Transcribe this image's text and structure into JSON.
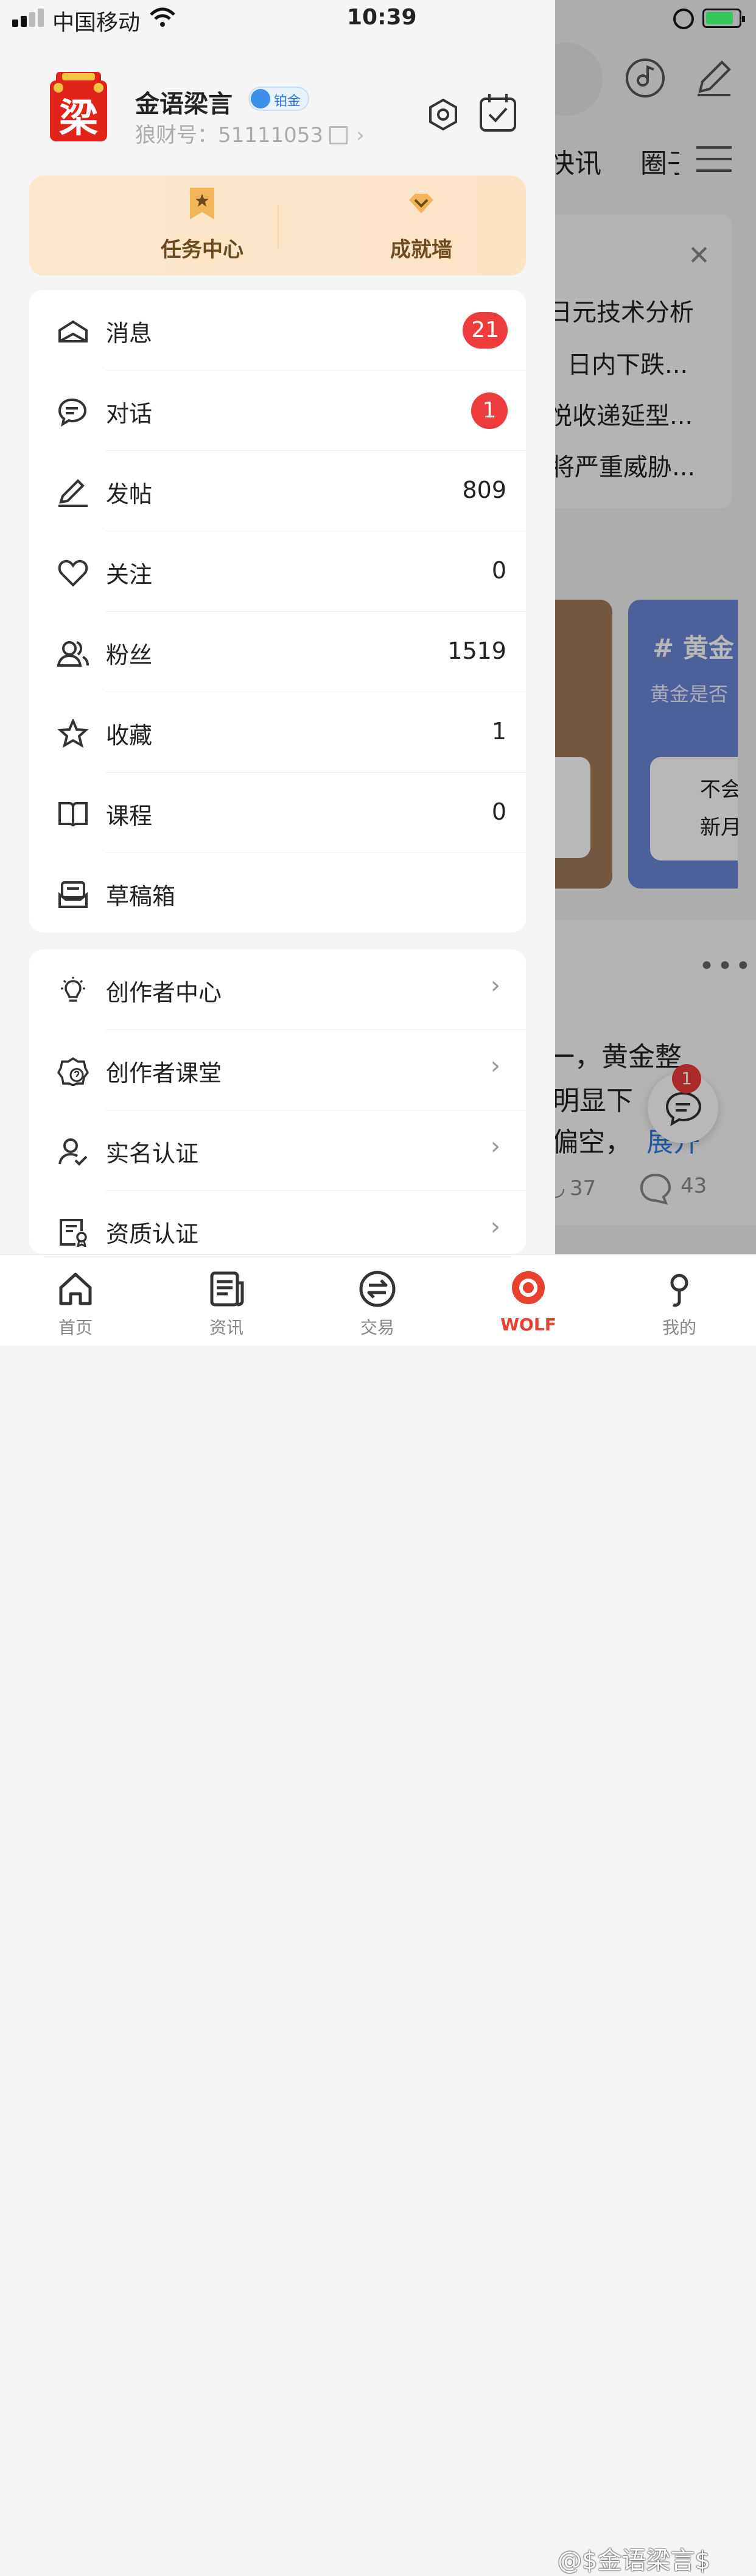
{
  "status": {
    "carrier": "中国移动",
    "time": "10:39"
  },
  "profile": {
    "name": "金语梁言",
    "tier": "铂金",
    "id_label": "狼财号：",
    "id": "51111053",
    "avatar_text": "梁"
  },
  "task_card": {
    "task_center": "任务中心",
    "achievement_wall": "成就墙"
  },
  "menu": [
    {
      "label": "消息",
      "badge": "21"
    },
    {
      "label": "对话",
      "badge": "1"
    },
    {
      "label": "发帖",
      "value": "809"
    },
    {
      "label": "关注",
      "value": "0"
    },
    {
      "label": "粉丝",
      "value": "1519"
    },
    {
      "label": "收藏",
      "value": "1"
    },
    {
      "label": "课程",
      "value": "0"
    },
    {
      "label": "草稿箱"
    }
  ],
  "creator_menu": [
    {
      "label": "创作者中心"
    },
    {
      "label": "创作者课堂"
    },
    {
      "label": "实名认证"
    },
    {
      "label": "资质认证"
    }
  ],
  "background": {
    "tab_news": "快讯",
    "tab_circle": "圈子",
    "lines": [
      "日元技术分析",
      "日内下跌...",
      "悦收递延型...",
      "将严重威胁..."
    ],
    "card_tag": "# 黄金",
    "card_sub": "黄金是否",
    "card_item1": "不会",
    "card_item2": "新月",
    "post_line1": "一，黄金整",
    "post_line2": "明显下",
    "post_line3": "偏空，",
    "post_more": "展开",
    "likes": "37",
    "comments": "43",
    "chat_badge": "1"
  },
  "tabbar": [
    {
      "label": "首页"
    },
    {
      "label": "资讯"
    },
    {
      "label": "交易"
    },
    {
      "label": "WOLF"
    },
    {
      "label": "我的"
    }
  ],
  "watermark": "@$金语梁言$",
  "colors": {
    "badge": "#ee3b3b",
    "wolf": "#e8412e",
    "gold_card": "#fbe8cc",
    "blue_card": "#6d86d6",
    "brown_card": "#a07a58"
  }
}
